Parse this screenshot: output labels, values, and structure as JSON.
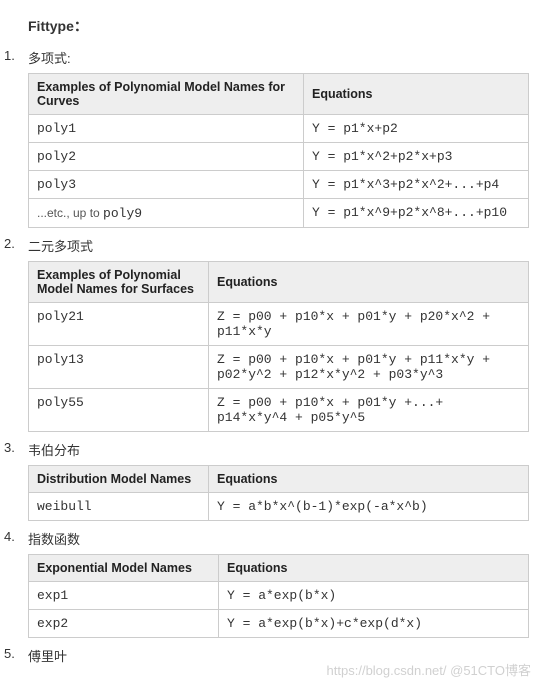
{
  "title": "Fittype：",
  "sections": [
    {
      "num": "1.",
      "label": "多项式:",
      "table": {
        "cls": "t1",
        "headers": [
          "Examples of Polynomial Model Names for Curves",
          "Equations"
        ],
        "rows": [
          {
            "name": "poly1",
            "eq": "Y = p1*x+p2",
            "plain": false
          },
          {
            "name": "poly2",
            "eq": "Y = p1*x^2+p2*x+p3",
            "plain": false
          },
          {
            "name": "poly3",
            "eq": "Y = p1*x^3+p2*x^2+...+p4",
            "plain": false
          },
          {
            "prefix": "...etc., up to ",
            "name": "poly9",
            "eq": "Y = p1*x^9+p2*x^8+...+p10",
            "plain": false
          }
        ]
      }
    },
    {
      "num": "2.",
      "label": "二元多项式",
      "table": {
        "cls": "t2",
        "headers": [
          "Examples of Polynomial Model Names for Surfaces",
          "Equations"
        ],
        "rows": [
          {
            "name": "poly21",
            "eq": "Z = p00 + p10*x + p01*y + p20*x^2 + p11*x*y"
          },
          {
            "name": "poly13",
            "eq": "Z = p00 + p10*x + p01*y + p11*x*y + p02*y^2 + p12*x*y^2 + p03*y^3"
          },
          {
            "name": "poly55",
            "eq": "Z = p00 + p10*x + p01*y +...+ p14*x*y^4 + p05*y^5"
          }
        ]
      }
    },
    {
      "num": "3.",
      "label": "韦伯分布",
      "table": {
        "cls": "t3",
        "headers": [
          "Distribution Model Names",
          "Equations"
        ],
        "rows": [
          {
            "name": "weibull",
            "eq": "Y = a*b*x^(b-1)*exp(-a*x^b)"
          }
        ]
      }
    },
    {
      "num": "4.",
      "label": "指数函数",
      "table": {
        "cls": "t4",
        "headers": [
          "Exponential Model Names",
          "Equations"
        ],
        "rows": [
          {
            "name": "exp1",
            "eq": "Y = a*exp(b*x)"
          },
          {
            "name": "exp2",
            "eq": "Y = a*exp(b*x)+c*exp(d*x)"
          }
        ]
      }
    },
    {
      "num": "5.",
      "label": "傅里叶"
    }
  ],
  "watermark": "https://blog.csdn.net/ @51CTO博客"
}
